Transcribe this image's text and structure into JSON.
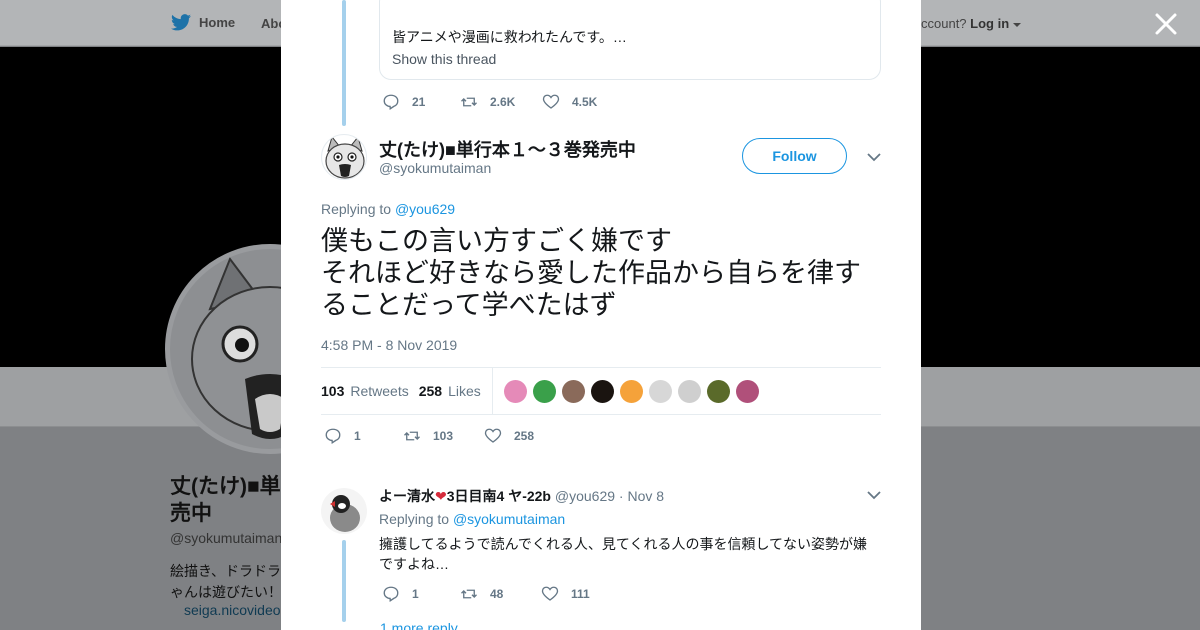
{
  "background": {
    "nav": {
      "home": "Home",
      "about": "Abo",
      "account_prompt": "ccount?",
      "login": "Log in"
    },
    "profile": {
      "name_line1": "丈(たけ)■単",
      "name_line2": "売中",
      "handle": "@syokumutaiman",
      "bio_line1": "絵描き、ドラドラ",
      "bio_line2": "ゃんは遊びたい！",
      "link": "seiga.nicovideo"
    }
  },
  "quoted": {
    "text": "皆アニメや漫画に救われたんです。…",
    "show_thread": "Show this thread",
    "replies": "21",
    "retweets": "2.6K",
    "likes": "4.5K"
  },
  "tweet": {
    "name": "丈(たけ)■単行本１～３巻発売中",
    "handle": "@syokumutaiman",
    "follow_label": "Follow",
    "replying_label": "Replying to",
    "replying_to": "@you629",
    "text_lines": [
      "僕もこの言い方すごく嫌です",
      "それほど好きなら愛した作品から自らを律す",
      "ることだって学べたはず"
    ],
    "timestamp": "4:58 PM - 8 Nov 2019",
    "retweet_count": "103",
    "retweets_label": "Retweets",
    "like_count": "258",
    "likes_label": "Likes",
    "actions": {
      "replies": "1",
      "retweets": "103",
      "likes": "258"
    }
  },
  "likers": [
    {
      "name": "liker-1",
      "color": "#e58ab8"
    },
    {
      "name": "liker-2",
      "color": "#3aa04a"
    },
    {
      "name": "liker-3",
      "color": "#8a6a5a"
    },
    {
      "name": "liker-4",
      "color": "#1a1410"
    },
    {
      "name": "liker-5",
      "color": "#f5a23a"
    },
    {
      "name": "liker-6",
      "color": "#d7d7d7"
    },
    {
      "name": "liker-7",
      "color": "#cfcfcf"
    },
    {
      "name": "liker-8",
      "color": "#5a6a2a"
    },
    {
      "name": "liker-9",
      "color": "#b0507a"
    }
  ],
  "reply": {
    "name": "よー清水",
    "name_suffix": "3日目南4 ヤ-22b",
    "handle": "@you629",
    "dot": "·",
    "date": "Nov 8",
    "replying_label": "Replying to",
    "replying_to": "@syokumutaiman",
    "text": "擁護してるようで読んでくれる人、見てくれる人の事を信頼してない姿勢が嫌ですよね…",
    "replies": "1",
    "retweets": "48",
    "likes": "111",
    "more_replies": "1 more reply"
  },
  "colors": {
    "accent": "#1b95e0",
    "thread_line": "#a5d0ec",
    "muted": "#657786"
  },
  "icons": [
    "twitter-bird-icon",
    "close-icon",
    "reply-icon",
    "retweet-icon",
    "heart-icon",
    "chevron-down-icon"
  ]
}
